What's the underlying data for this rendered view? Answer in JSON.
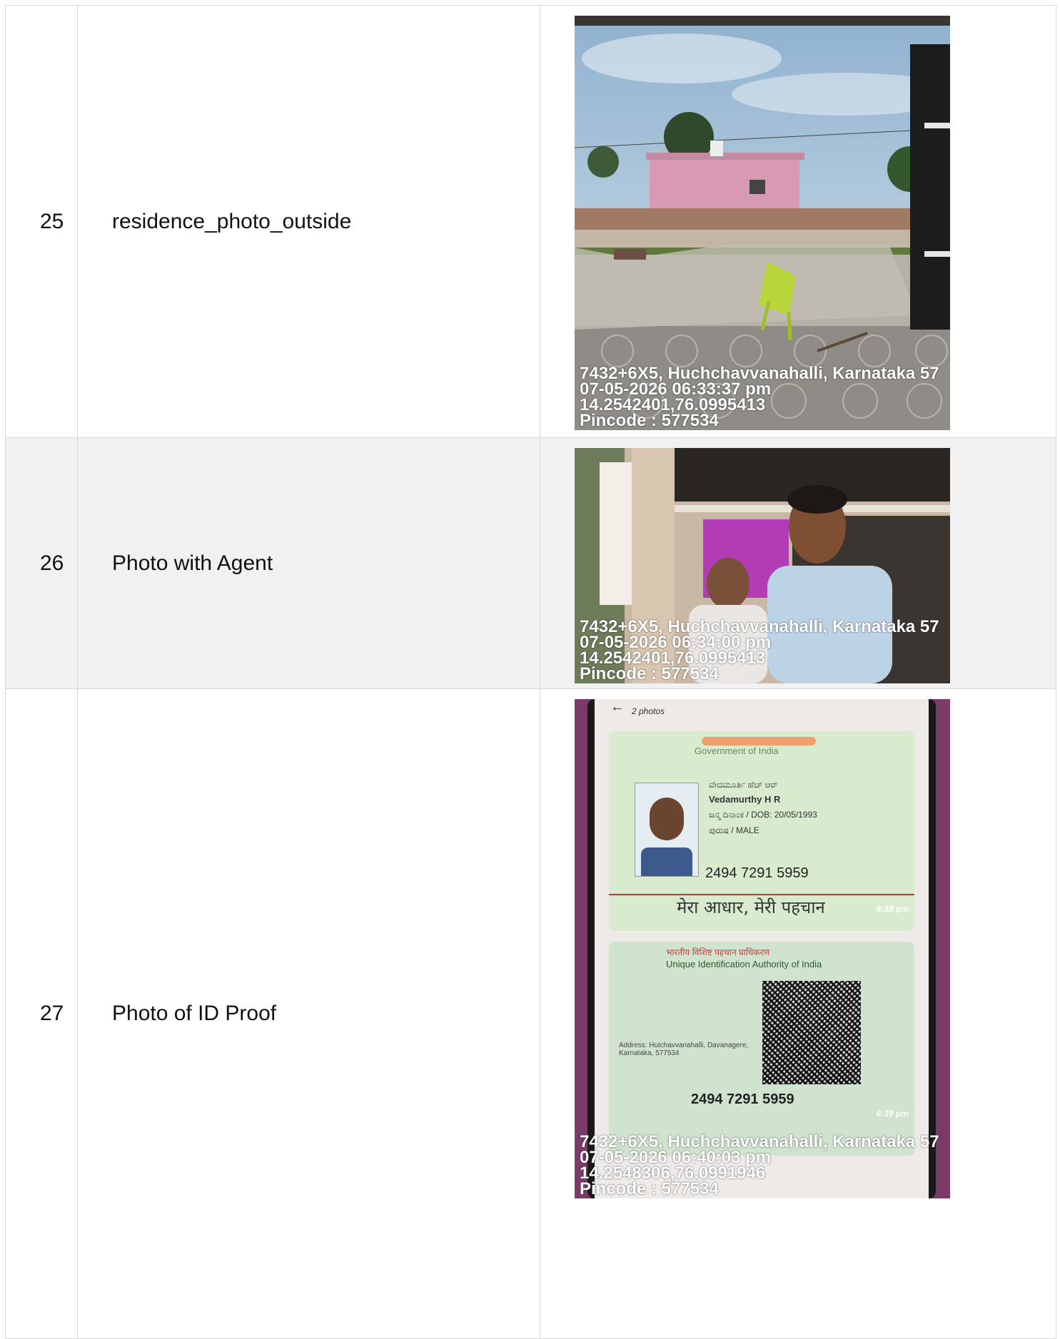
{
  "rows": [
    {
      "number": "25",
      "label": "residence_photo_outside",
      "stamp": {
        "address": "7432+6X5, Huchchavvanahalli, Karnataka 57",
        "datetime": "07-05-2026 06:33:37 pm",
        "coords": "14.2542401,76.0995413",
        "pincode": "Pincode : 577534"
      }
    },
    {
      "number": "26",
      "label": "Photo with Agent",
      "stamp": {
        "address": "7432+6X5, Huchchavvanahalli, Karnataka 57",
        "datetime": "07-05-2026 06:34:00 pm",
        "coords": "14.2542401,76.0995413",
        "pincode": "Pincode : 577534"
      }
    },
    {
      "number": "27",
      "label": "Photo of ID Proof",
      "stamp": {
        "address": "7432+6X5, Huchchavvanahalli, Karnataka 57",
        "datetime": "07-05-2026 06:40:03 pm",
        "coords": "14.2548306,76.0991946",
        "pincode": "Pincode : 577534"
      },
      "phone_screen": {
        "photos_count": "2 photos",
        "card_front": {
          "govt": "Government of India",
          "name_local": "ವೇದಮೂರ್ತಿ ಹೆಚ್ ಆರ್",
          "name": "Vedamurthy H R",
          "dob": "ಜನ್ಮ ದಿನಾಂಕ / DOB: 20/05/1993",
          "gender": "ಪುರುಷ / MALE",
          "number": "2494 7291 5959",
          "tagline": "मेरा आधार, मेरी पहचान",
          "time": "6:39 pm"
        },
        "card_back": {
          "authority_hi": "भारतीय विशिष्ट पहचान प्राधिकरण",
          "authority": "Unique Identification Authority of India",
          "address": "Address: Hutchavvanahalli, Davanagere, Karnataka, 577534",
          "number": "2494 7291 5959",
          "time": "6:39 pm"
        }
      }
    }
  ]
}
